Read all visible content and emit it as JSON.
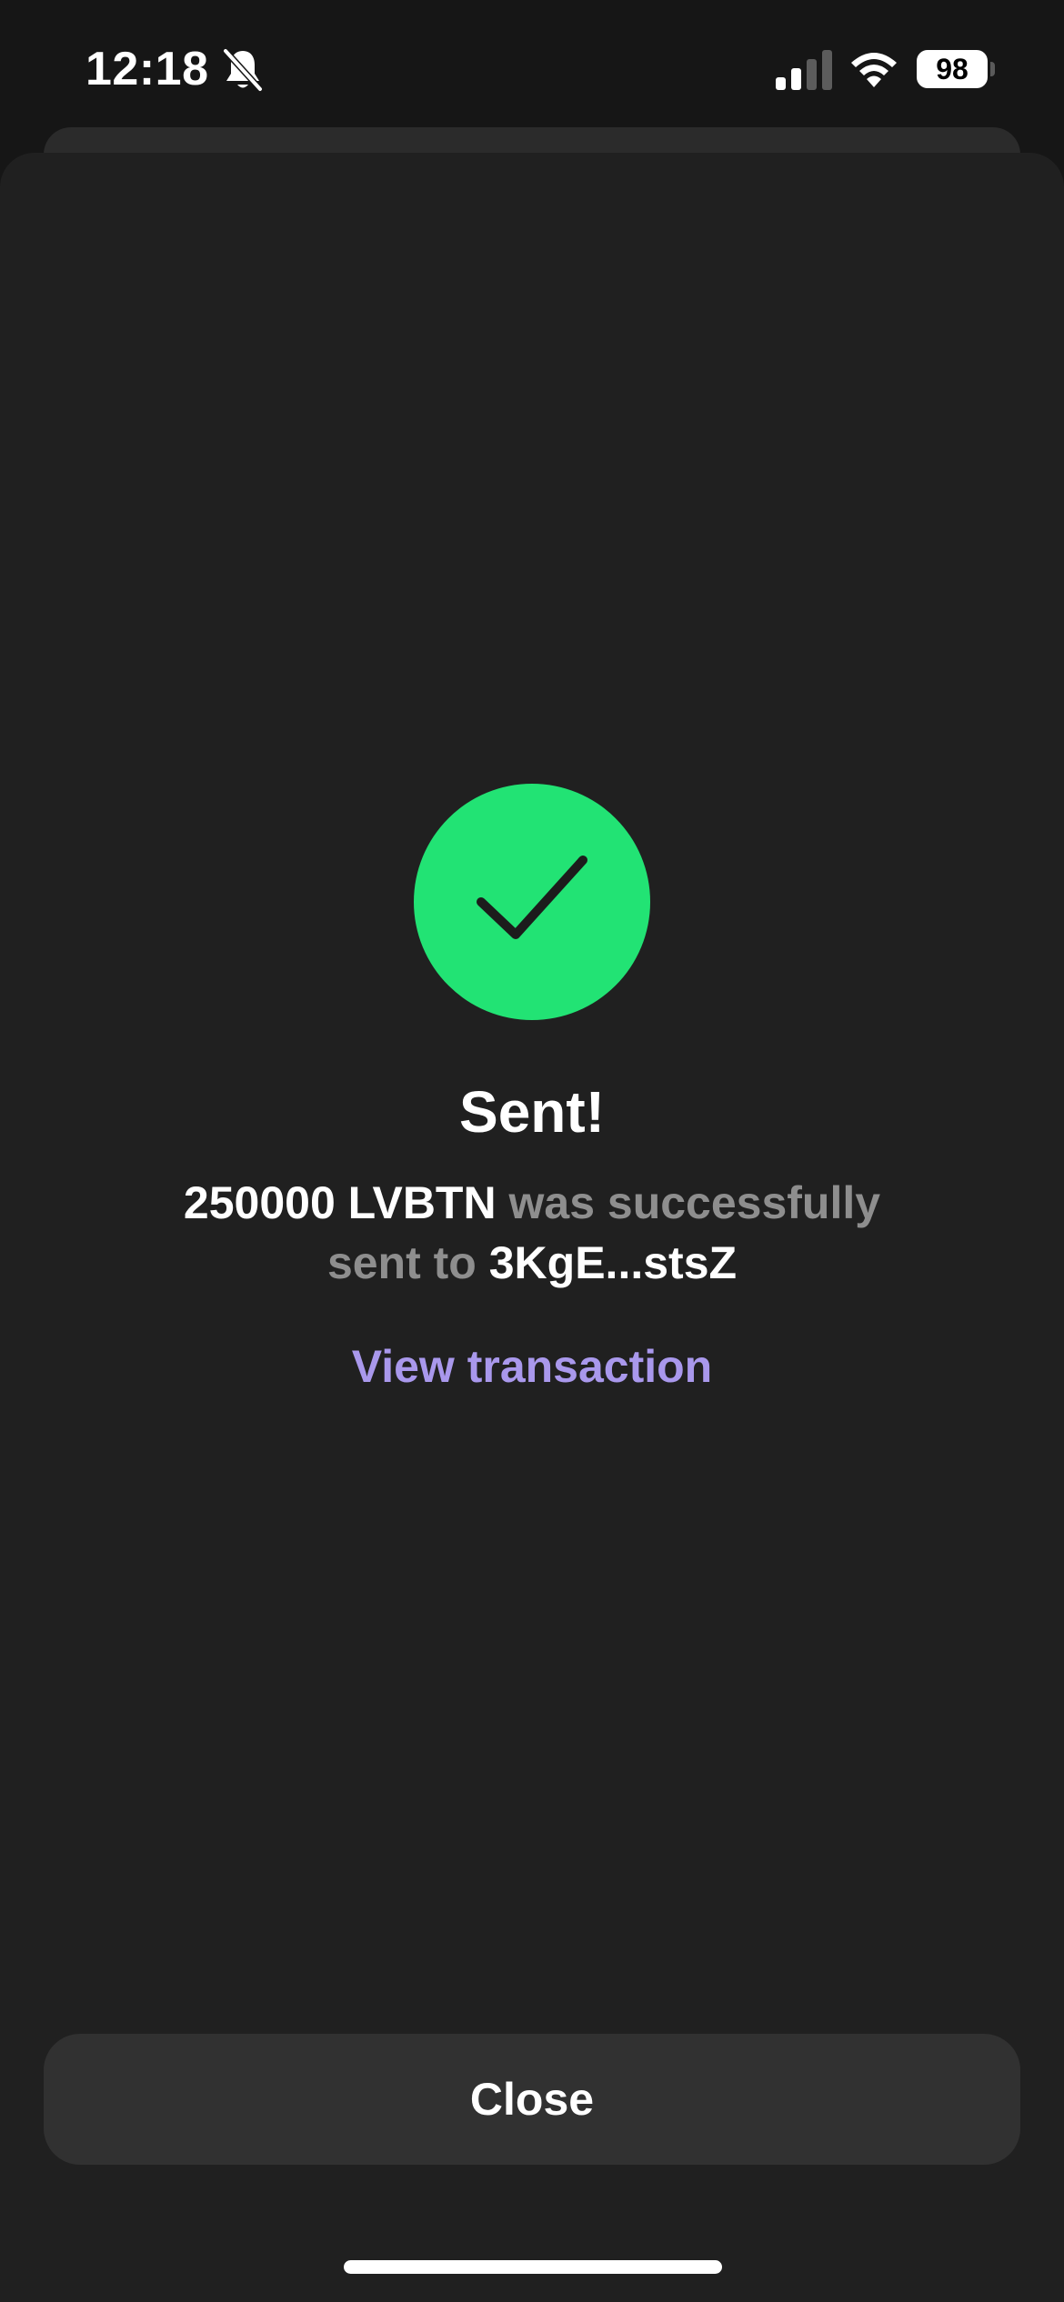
{
  "status_bar": {
    "time": "12:18",
    "battery": "98",
    "icons": [
      "bell-slash-icon",
      "cellular-signal-icon",
      "wifi-icon",
      "battery-icon"
    ]
  },
  "result": {
    "icon": "checkmark-icon",
    "title": "Sent!",
    "amount": "250000 LVBTN",
    "middle_text": "was successfully",
    "sent_to_text": "sent to",
    "recipient": "3KgE...stsZ",
    "view_link": "View transaction"
  },
  "actions": {
    "close_label": "Close"
  },
  "colors": {
    "background": "#161616",
    "sheet": "#202020",
    "success": "#22e374",
    "link": "#a998ec",
    "button": "#313131",
    "muted_text": "#8e8e8e"
  }
}
